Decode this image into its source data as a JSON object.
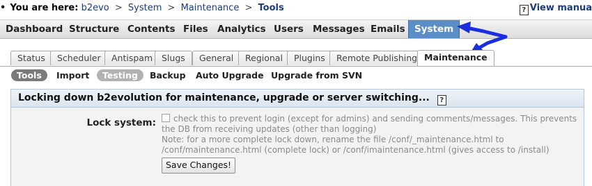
{
  "breadcrumb": {
    "bullet": "•",
    "prefix": "You are here:",
    "items": [
      "b2evo",
      "System",
      "Maintenance"
    ],
    "separator": ">",
    "current": "Tools"
  },
  "manual_link": "View manua",
  "main_menu": [
    "Dashboard",
    "Structure",
    "Contents",
    "Files",
    "Analytics",
    "Users",
    "Messages",
    "Emails",
    "System"
  ],
  "tabs": [
    "Status",
    "Scheduler",
    "Antispam",
    "Slugs",
    "General",
    "Regional",
    "Plugins",
    "Remote Publishing",
    "Maintenance"
  ],
  "subtabs": [
    "Tools",
    "Import",
    "Testing",
    "Backup",
    "Auto Upgrade",
    "Upgrade from SVN"
  ],
  "panel": {
    "title": "Locking down b2evolution for maintenance, upgrade or server switching...",
    "label": "Lock system:",
    "checkbox_text": "check this to prevent login (except for admins) and sending comments/messages. This prevents the DB from receiving updates (other than logging)",
    "note": "Note: for a more complete lock down, rename the file /conf/_maintenance.html to /conf/maintenance.html (complete lock) or /conf/imaintenance.html (gives access to /install)",
    "button": "Save Changes!"
  },
  "colors": {
    "link": "#1c3c7a",
    "menu_active": "#5b8dc6",
    "arrow": "#1a2ee0"
  },
  "icons": {
    "help": "help-book-icon",
    "arrows": "annotation-arrow-icon"
  }
}
